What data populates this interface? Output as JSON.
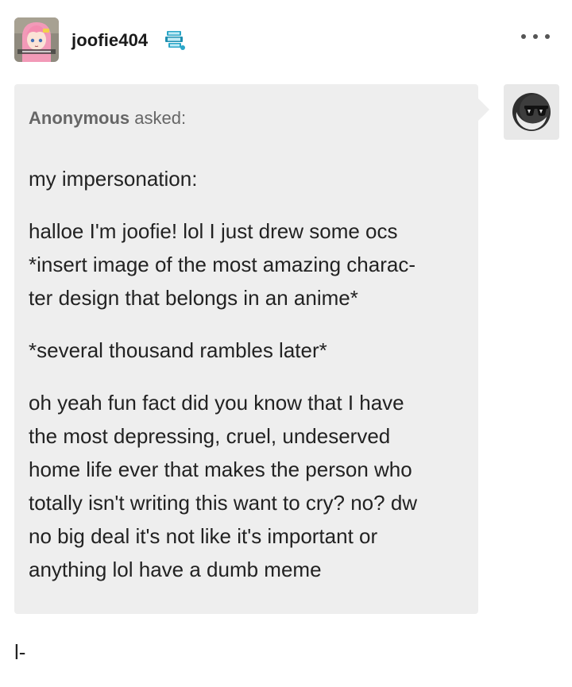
{
  "header": {
    "username": "joofie404",
    "avatar_icon": "anime-girl-avatar-icon",
    "badge_icon": "blue-tumblr-badge-icon",
    "more_icon": "more-options-icon"
  },
  "ask": {
    "asker_name": "Anonymous",
    "asker_suffix": " asked:",
    "asker_avatar_icon": "anonymous-sunglasses-icon",
    "paragraphs": [
      [
        "my impersonation:"
      ],
      [
        "halloe I'm joofie! lol I just drew some ocs",
        "*insert image of the most amazing charac-",
        "ter design that belongs in an anime*"
      ],
      [
        "*several thousand rambles later*"
      ],
      [
        "oh yeah fun fact did you know that I have",
        "the most depressing, cruel, undeserved",
        "home life ever that makes the person who",
        "totally isn't writing this want to cry? no? dw",
        "no big deal it's not like it's important or",
        "anything lol have a dumb meme"
      ]
    ]
  },
  "footer": {
    "text": "l-"
  },
  "colors": {
    "bubble_bg": "#eeeeee",
    "text": "#222222",
    "muted": "#666666",
    "badge": "#2aa6c8"
  }
}
